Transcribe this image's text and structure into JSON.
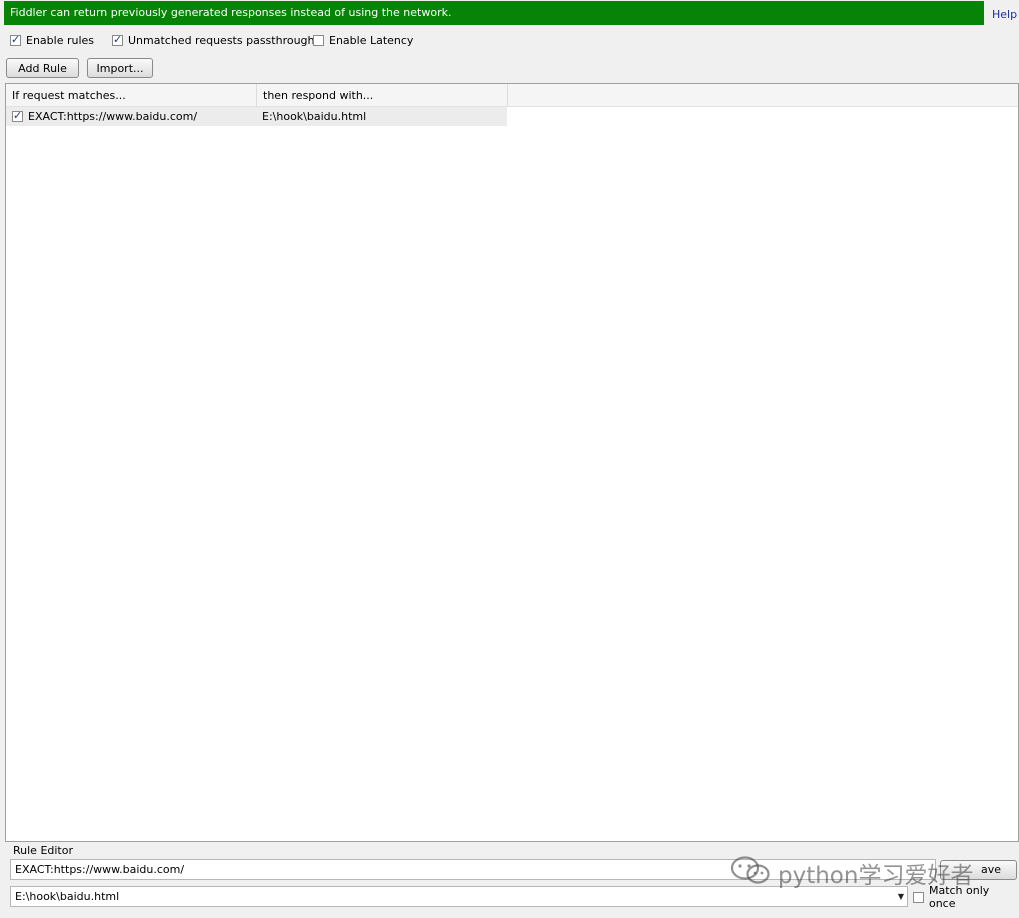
{
  "banner": {
    "text": "Fiddler can return previously generated responses instead of using the network.",
    "help": "Help"
  },
  "options": [
    {
      "label": "Enable rules",
      "checked": true
    },
    {
      "label": "Unmatched requests passthrough",
      "checked": true
    },
    {
      "label": "Enable Latency",
      "checked": false
    }
  ],
  "toolbar": {
    "add_rule": "Add Rule",
    "import": "Import..."
  },
  "columns": [
    "If request matches...",
    "then respond with..."
  ],
  "rules": [
    {
      "enabled": true,
      "match": "EXACT:https://www.baidu.com/",
      "respond": "E:\\hook\\baidu.html"
    }
  ],
  "editor": {
    "label": "Rule Editor",
    "match_value": "EXACT:https://www.baidu.com/",
    "respond_value": "E:\\hook\\baidu.html",
    "save_label": "ave",
    "match_once_label": "Match only once",
    "match_once_checked": false
  },
  "watermark": {
    "icon": "wechat-icon",
    "text": "python学习爱好者"
  },
  "colors": {
    "banner": "#078407",
    "help_link": "#1a2fa8"
  }
}
